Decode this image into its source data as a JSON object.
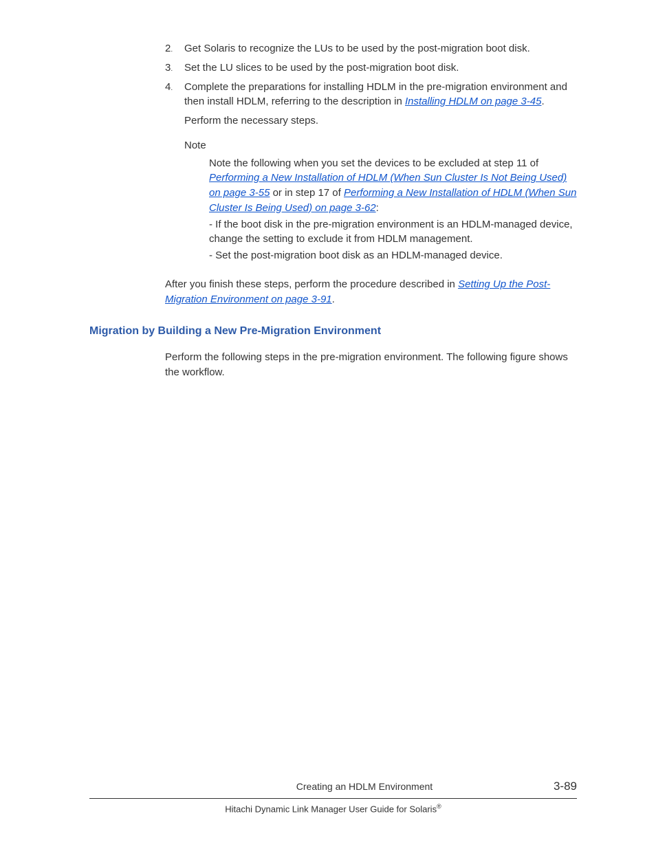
{
  "list": {
    "item2": {
      "number": "2",
      "text": "Get Solaris to recognize the LUs to be used by the post-migration boot disk."
    },
    "item3": {
      "number": "3",
      "text": "Set the LU slices to be used by the post-migration boot disk."
    },
    "item4": {
      "number": "4",
      "text_part1": "Complete the preparations for installing HDLM in the pre-migration environment and then install HDLM, referring to the description in ",
      "link1": "Installing HDLM on page 3-45",
      "text_part2": ".",
      "perform": "Perform the necessary steps.",
      "note_label": "Note",
      "note_p1_a": "Note the following when you set the devices to be excluded at step 11 of ",
      "note_link1": "Performing a New Installation of HDLM (When Sun Cluster Is Not Being Used) on page 3-55",
      "note_p1_b": " or in step 17 of ",
      "note_link2": "Performing a New Installation of HDLM (When Sun Cluster Is Being Used) on page 3-62",
      "note_p1_c": ":",
      "note_bullet1": "- If the boot disk in the pre-migration environment is an HDLM-managed device, change the setting to exclude it from HDLM management.",
      "note_bullet2": "- Set the post-migration boot disk as an HDLM-managed device."
    }
  },
  "after": {
    "text_a": "After you finish these steps, perform the procedure described in ",
    "link": "Setting Up the Post-Migration Environment on page 3-91",
    "text_b": "."
  },
  "heading": "Migration by Building a New Pre-Migration Environment",
  "section_para": "Perform the following steps in the pre-migration environment. The following figure shows the workflow.",
  "footer": {
    "chapter": "Creating an HDLM Environment",
    "page": "3-89",
    "guide_a": "Hitachi Dynamic Link Manager User Guide for Solaris",
    "guide_sup": "®"
  }
}
